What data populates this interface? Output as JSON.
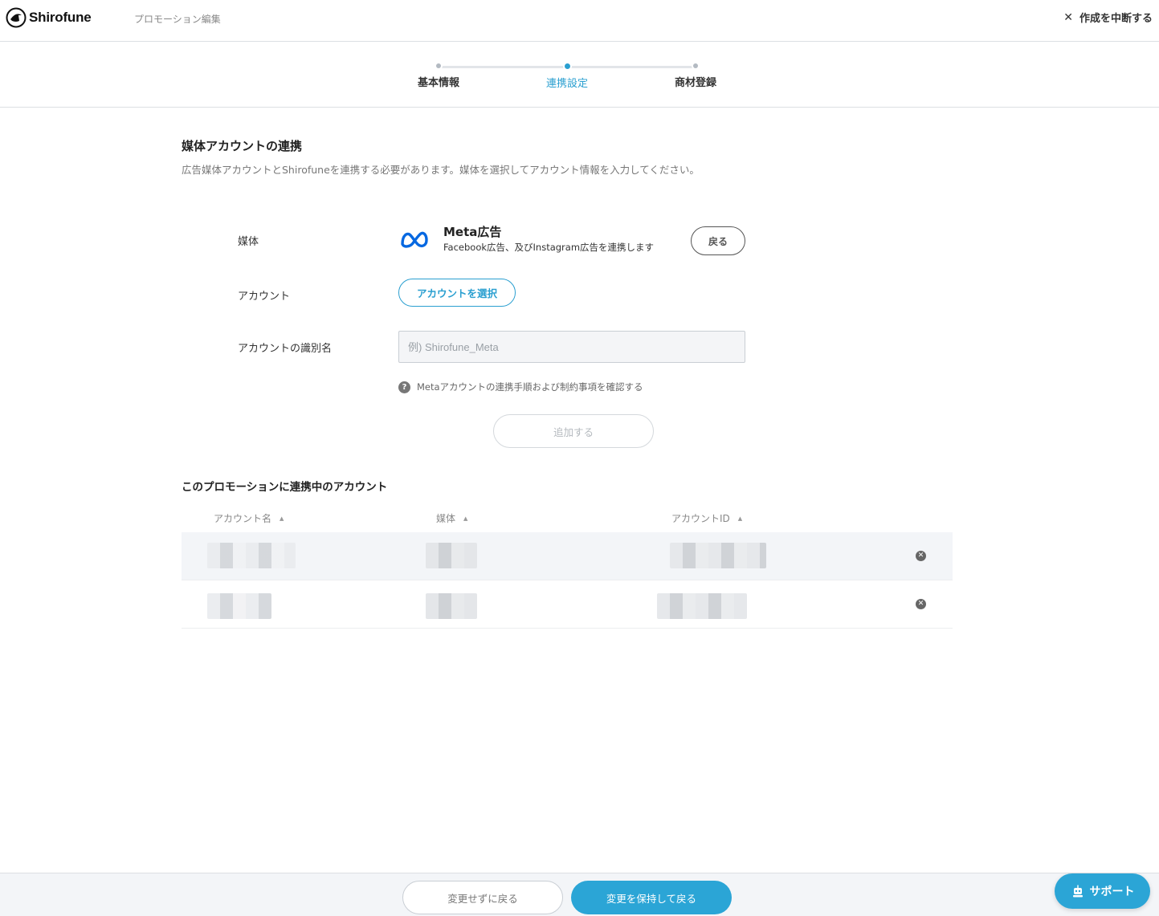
{
  "header": {
    "app_name": "Shirofune",
    "page_name": "プロモーション編集",
    "cancel_label": "作成を中断する"
  },
  "stepper": {
    "steps": [
      {
        "label": "基本情報",
        "state": "done"
      },
      {
        "label": "連携設定",
        "state": "current"
      },
      {
        "label": "商材登録",
        "state": "todo"
      }
    ]
  },
  "section": {
    "title": "媒体アカウントの連携",
    "description": "広告媒体アカウントとShirofuneを連携する必要があります。媒体を選択してアカウント情報を入力してください。"
  },
  "form": {
    "media_label": "媒体",
    "media_name": "Meta広告",
    "media_description": "Facebook広告、及びInstagram広告を連携します",
    "back_button": "戻る",
    "account_label": "アカウント",
    "select_account_button": "アカウントを選択",
    "identifier_label": "アカウントの識別名",
    "identifier_placeholder": "例) Shirofune_Meta",
    "identifier_value": "",
    "help_link": "Metaアカウントの連携手順および制約事項を確認する",
    "add_button": "追加する"
  },
  "linked_accounts": {
    "title": "このプロモーションに連携中のアカウント",
    "columns": [
      "アカウント名",
      "媒体",
      "アカウントID"
    ],
    "rows": [
      {
        "redacted": true
      },
      {
        "redacted": true
      }
    ]
  },
  "footer": {
    "discard_button": "変更せずに戻る",
    "save_button": "変更を保持して戻る",
    "support_button": "サポート"
  },
  "colors": {
    "accent": "#2ba5d6",
    "meta_blue": "#0668e1"
  }
}
